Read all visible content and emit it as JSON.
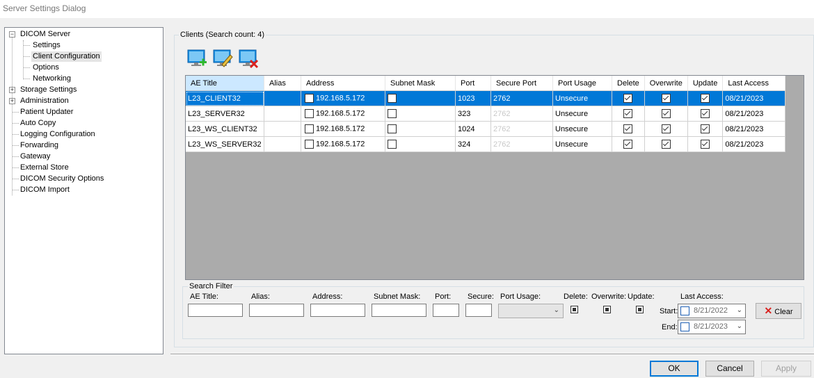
{
  "window": {
    "title": "Server Settings Dialog"
  },
  "tree": {
    "dicom_server": "DICOM Server",
    "settings": "Settings",
    "client_configuration": "Client Configuration",
    "options": "Options",
    "networking": "Networking",
    "storage_settings": "Storage Settings",
    "administration": "Administration",
    "patient_updater": "Patient Updater",
    "auto_copy": "Auto Copy",
    "logging_configuration": "Logging Configuration",
    "forwarding": "Forwarding",
    "gateway": "Gateway",
    "external_store": "External Store",
    "dicom_security_options": "DICOM Security Options",
    "dicom_import": "DICOM Import",
    "selected": "Client Configuration"
  },
  "clients": {
    "group_label": "Clients (Search count: 4)",
    "toolbar": {
      "add_icon": "add-client-icon",
      "edit_icon": "edit-client-icon",
      "delete_icon": "delete-client-icon"
    },
    "columns": [
      "AE Title",
      "Alias",
      "Address",
      "Subnet Mask",
      "Port",
      "Secure Port",
      "Port Usage",
      "Delete",
      "Overwrite",
      "Update",
      "Last Access"
    ],
    "rows": [
      {
        "ae_title": "L23_CLIENT32",
        "alias": "",
        "address": "192.168.5.172",
        "port": "1023",
        "secure_port": "2762",
        "port_usage": "Unsecure",
        "last_access": "08/21/2023",
        "selected": true
      },
      {
        "ae_title": "L23_SERVER32",
        "alias": "",
        "address": "192.168.5.172",
        "port": "323",
        "secure_port": "2762",
        "port_usage": "Unsecure",
        "last_access": "08/21/2023",
        "selected": false
      },
      {
        "ae_title": "L23_WS_CLIENT32",
        "alias": "",
        "address": "192.168.5.172",
        "port": "1024",
        "secure_port": "2762",
        "port_usage": "Unsecure",
        "last_access": "08/21/2023",
        "selected": false
      },
      {
        "ae_title": "L23_WS_SERVER32",
        "alias": "",
        "address": "192.168.5.172",
        "port": "324",
        "secure_port": "2762",
        "port_usage": "Unsecure",
        "last_access": "08/21/2023",
        "selected": false
      }
    ]
  },
  "filter": {
    "group_label": "Search Filter",
    "ae_title_label": "AE Title:",
    "alias_label": "Alias:",
    "address_label": "Address:",
    "subnet_label": "Subnet Mask:",
    "port_label": "Port:",
    "secure_label": "Secure:",
    "port_usage_label": "Port Usage:",
    "delete_label": "Delete:",
    "overwrite_label": "Overwrite:",
    "update_label": "Update:",
    "last_access_label": "Last Access:",
    "start_label": "Start:",
    "end_label": "End:",
    "start_date": "8/21/2022",
    "end_date": "8/21/2023",
    "clear_label": "Clear",
    "clear_icon": "red-x-icon"
  },
  "buttons": {
    "ok": "OK",
    "cancel": "Cancel",
    "apply": "Apply"
  }
}
